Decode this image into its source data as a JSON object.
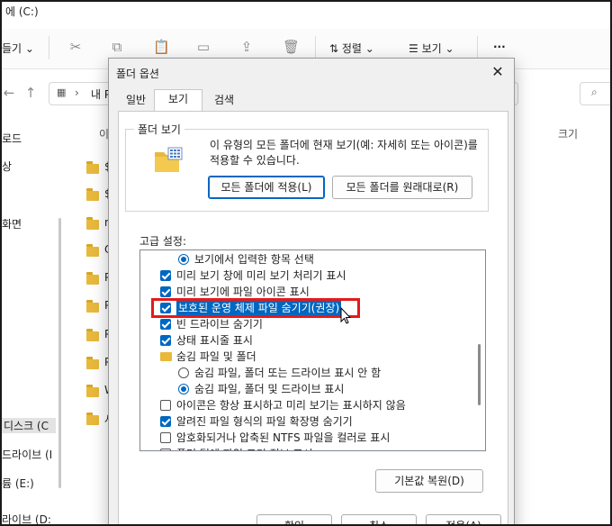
{
  "explorer": {
    "title_fragment": "에 (C:)",
    "toolbar": {
      "new_fragment": "들기",
      "sort_label": "정렬",
      "view_label": "보기",
      "more_label": "···"
    },
    "address_fragment": "내 P",
    "column_name_fragment": "이",
    "column_size": "크기",
    "nav_items": [
      "로드",
      "상",
      "화면",
      "디스크 (C",
      "드라이브 (I",
      "륨 (E:)",
      "라이브 (D:"
    ],
    "folder_items": [
      "$",
      "$",
      "n",
      "O",
      "P",
      "P",
      "P",
      "P",
      "W",
      "사"
    ]
  },
  "dialog": {
    "title": "폴더 옵션",
    "close_label": "✕",
    "tabs": [
      "일반",
      "보기",
      "검색"
    ],
    "active_tab": "보기",
    "folder_view": {
      "legend": "폴더 보기",
      "description": "이 유형의 모든 폴더에 현재 보기(예: 자세히 또는 아이콘)를 적용할 수 있습니다.",
      "apply_button": "모든 폴더에 적용(L)",
      "reset_button": "모든 폴더를 원래대로(R)"
    },
    "advanced_label": "고급 설정:",
    "advanced_items": [
      {
        "type": "radio",
        "checked": true,
        "text": "보기에서 입력한 항목 선택",
        "indent": 1
      },
      {
        "type": "checkbox",
        "checked": true,
        "text": "미리 보기 창에 미리 보기 처리기 표시",
        "indent": 0
      },
      {
        "type": "checkbox",
        "checked": true,
        "text": "미리 보기에 파일 아이콘 표시",
        "indent": 0
      },
      {
        "type": "checkbox",
        "checked": true,
        "text": "보호된 운영 체제 파일 숨기기(권장)",
        "indent": 0,
        "selected": true
      },
      {
        "type": "checkbox",
        "checked": true,
        "text": "빈 드라이브 숨기기",
        "indent": 0
      },
      {
        "type": "checkbox",
        "checked": true,
        "text": "상태 표시줄 표시",
        "indent": 0
      },
      {
        "type": "folder",
        "text": "숨김 파일 및 폴더",
        "indent": 0
      },
      {
        "type": "radio",
        "checked": false,
        "text": "숨김 파일, 폴더 또는 드라이브 표시 안 함",
        "indent": 1
      },
      {
        "type": "radio",
        "checked": true,
        "text": "숨김 파일, 폴더 및 드라이브 표시",
        "indent": 1
      },
      {
        "type": "checkbox",
        "checked": false,
        "text": "아이콘은 항상 표시하고 미리 보기는 표시하지 않음",
        "indent": 0
      },
      {
        "type": "checkbox",
        "checked": true,
        "text": "알려진 파일 형식의 파일 확장명 숨기기",
        "indent": 0
      },
      {
        "type": "checkbox",
        "checked": false,
        "text": "암호화되거나 압축된 NTFS 파일을 컬러로 표시",
        "indent": 0
      },
      {
        "type": "checkbox",
        "checked": false,
        "text": "폴더 팁에 파일 크기 정보 표시",
        "indent": 0
      }
    ],
    "restore_defaults_button": "기본값 복원(D)",
    "ok_button": "확인",
    "cancel_button": "취소",
    "apply_button": "적용(A)"
  },
  "colors": {
    "accent": "#0067c0",
    "highlight_box": "#e41a1a",
    "folder": "#e8b93c"
  }
}
